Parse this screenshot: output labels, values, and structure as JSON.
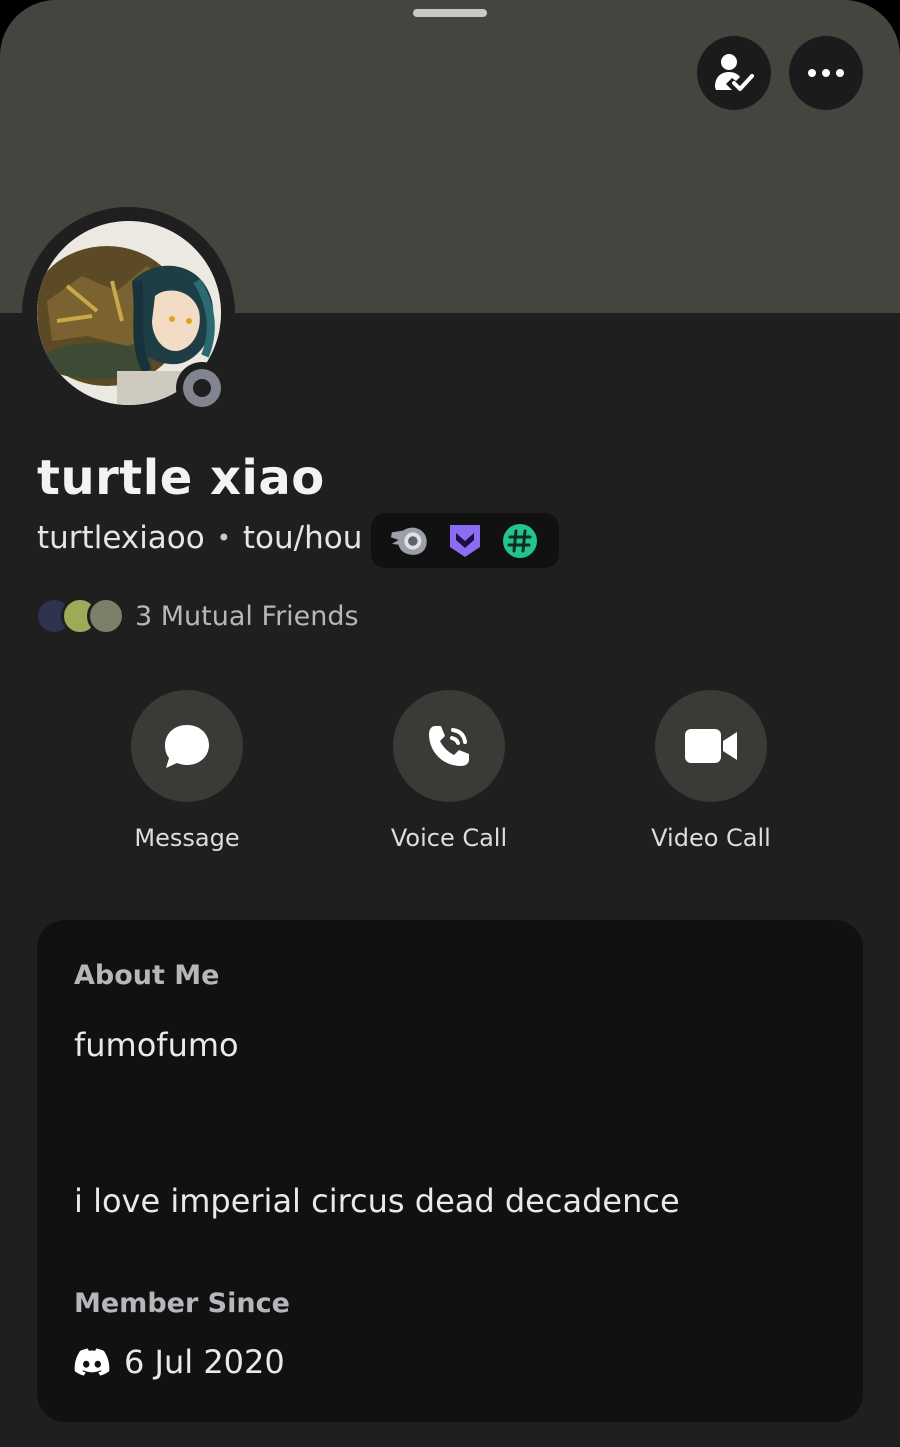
{
  "profile": {
    "display_name": "turtle xiao",
    "username": "turtlexiaoo",
    "separator": "•",
    "pronouns": "tou/hou",
    "status": "offline",
    "badges": [
      {
        "icon": "hypesquad-icon"
      },
      {
        "icon": "nitro-icon"
      },
      {
        "icon": "hashtag-icon"
      }
    ],
    "mutual_friends_text": "3 Mutual Friends"
  },
  "header": {
    "friend_button_icon": "friend-check-icon",
    "more_button_icon": "more-dots-icon"
  },
  "actions": [
    {
      "label": "Message",
      "icon": "chat-bubble-icon"
    },
    {
      "label": "Voice Call",
      "icon": "phone-icon"
    },
    {
      "label": "Video Call",
      "icon": "video-camera-icon"
    }
  ],
  "about": {
    "heading": "About Me",
    "line1": "fumofumo",
    "line2": "i love imperial circus dead decadence"
  },
  "member_since": {
    "heading": "Member Since",
    "date": "6 Jul 2020",
    "icon": "discord-logo-icon"
  },
  "colors": {
    "banner": "#454540",
    "background": "#1f1f1f",
    "card": "#111111",
    "nitro": "#8c6cf0",
    "hashtag_badge": "#23c58f"
  }
}
